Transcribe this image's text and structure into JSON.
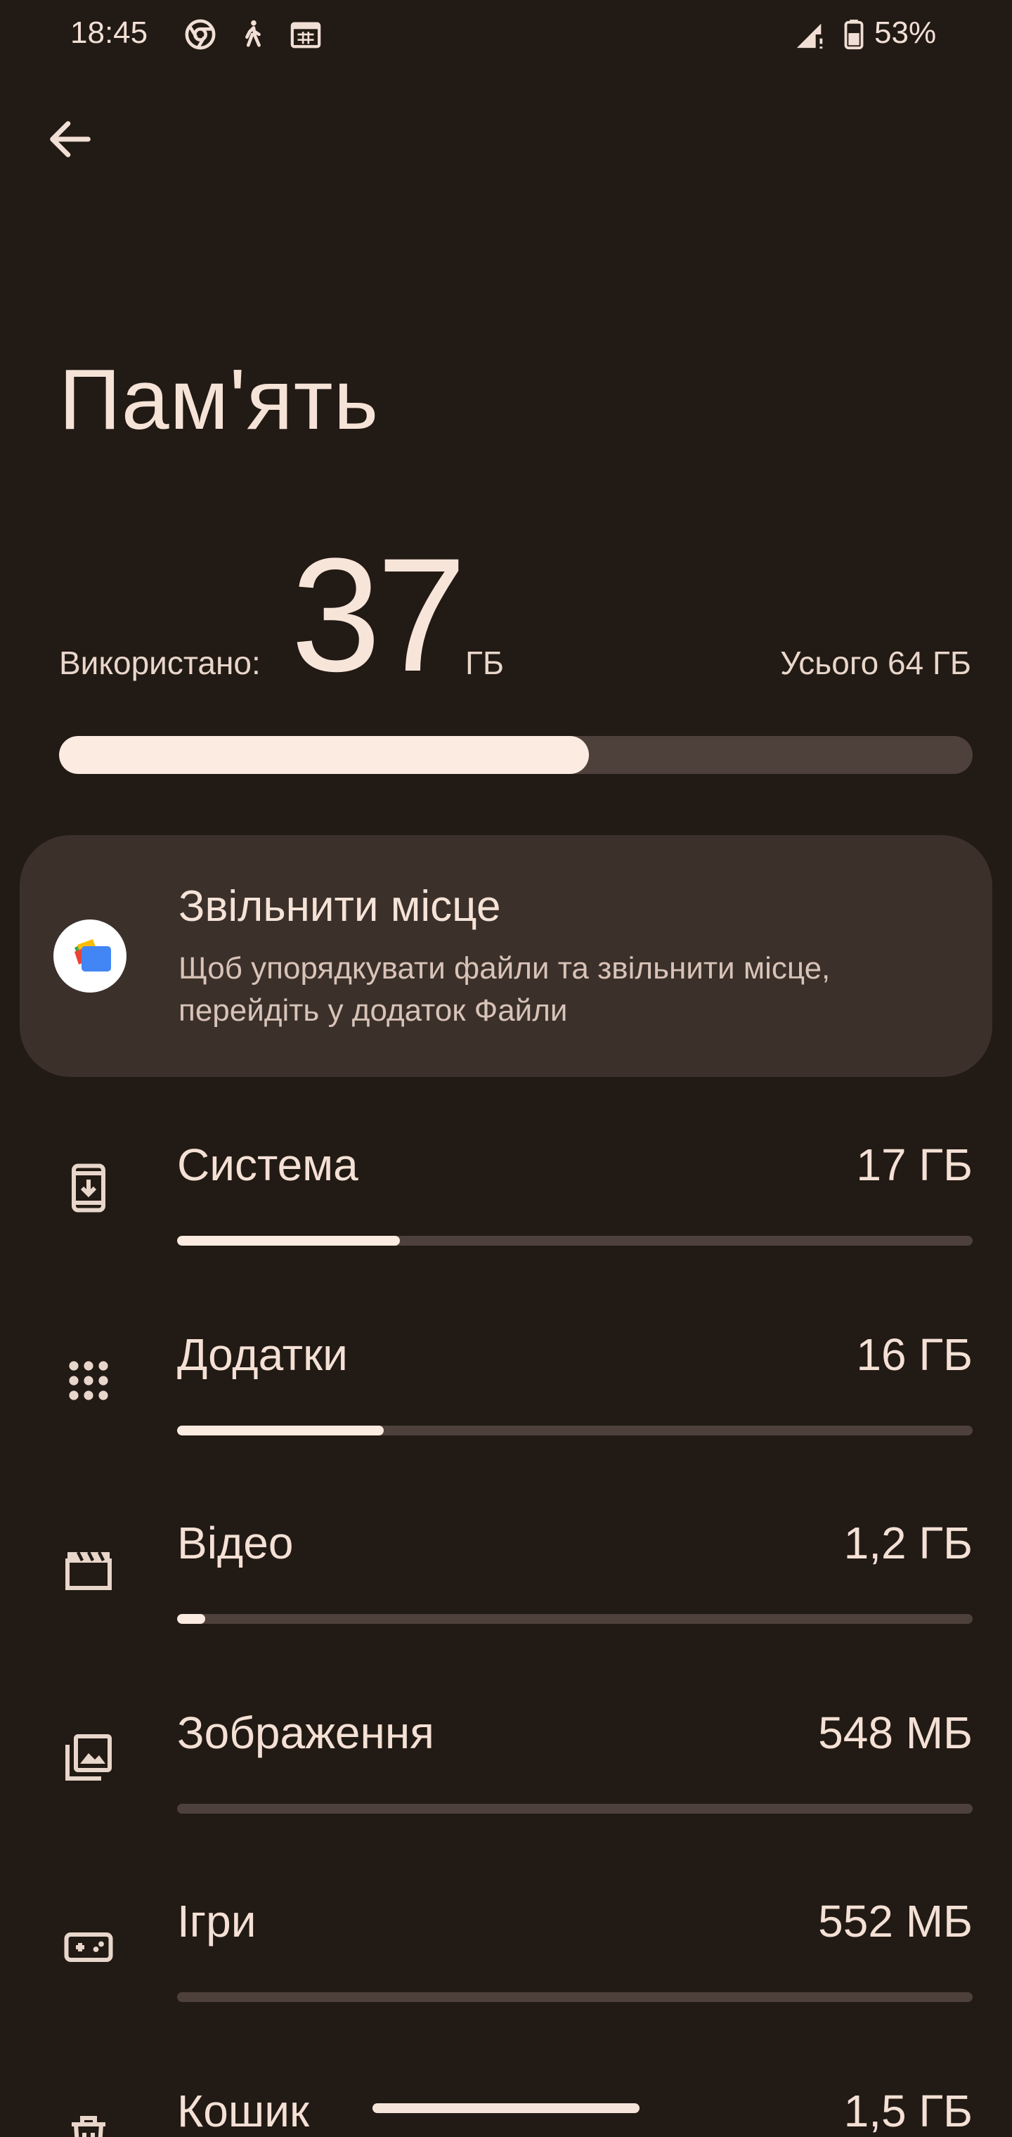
{
  "status_bar": {
    "time": "18:45",
    "battery": "53%",
    "icons": [
      "chrome-icon",
      "walk-icon",
      "calendar-icon",
      "signal-icon",
      "battery-icon"
    ]
  },
  "header": {
    "back_icon": "arrow-back-icon",
    "title": "Пам'ять"
  },
  "storage": {
    "used_label": "Використано:",
    "used_value": "37",
    "used_unit": "ГБ",
    "total": "Усього 64 ГБ",
    "used_fraction": 0.58
  },
  "free_space_card": {
    "title": "Звільнити місце",
    "subtitle": "Щоб упорядкувати файли та звільнити місце, перейдіть у додаток Файли",
    "icon": "files-app-icon"
  },
  "categories": [
    {
      "label": "Система",
      "value": "17 ГБ",
      "fraction": 0.28,
      "icon": "system-update-icon"
    },
    {
      "label": "Додатки",
      "value": "16 ГБ",
      "fraction": 0.26,
      "icon": "apps-grid-icon"
    },
    {
      "label": "Відео",
      "value": "1,2 ГБ",
      "fraction": 0.035,
      "icon": "movie-icon"
    },
    {
      "label": "Зображення",
      "value": "548 МБ",
      "fraction": 0.0,
      "icon": "photo-library-icon"
    },
    {
      "label": "Ігри",
      "value": "552 МБ",
      "fraction": 0.0,
      "icon": "gamepad-icon"
    },
    {
      "label": "Кошик",
      "value": "1,5 ГБ",
      "fraction": 0.0,
      "icon": "trash-icon"
    }
  ],
  "colors": {
    "background": "#221a14",
    "card": "#3b302a",
    "track": "#4e403a",
    "fill": "#fcebe1"
  }
}
